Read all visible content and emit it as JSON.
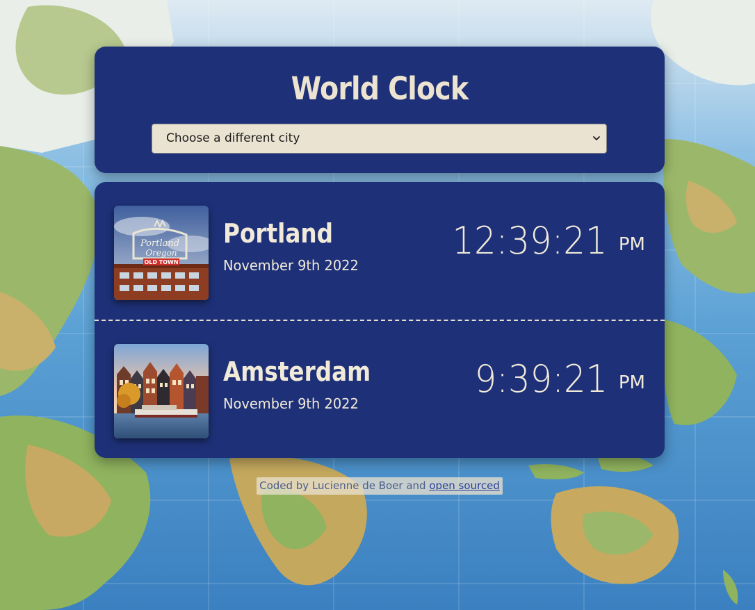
{
  "app": {
    "title": "World Clock"
  },
  "city_select": {
    "selected": "Choose a different city"
  },
  "cities": [
    {
      "name": "Portland",
      "date": "November 9th 2022",
      "time": "12:39:21",
      "ampm": "PM",
      "photo_sign_line1": "Portland",
      "photo_sign_line2": "Oregon",
      "photo_sign_line3": "OLD TOWN"
    },
    {
      "name": "Amsterdam",
      "date": "November 9th 2022",
      "time": "9:39:21",
      "ampm": "PM"
    }
  ],
  "footer": {
    "prefix": "Coded by Lucienne de Boer and ",
    "link_text": "open sourced"
  },
  "colors": {
    "card": "#1e3178",
    "text_light": "#f1ead9",
    "select_bg": "#ebe3d1",
    "ocean": "#4e8fc4",
    "land": "#9bb86a"
  }
}
